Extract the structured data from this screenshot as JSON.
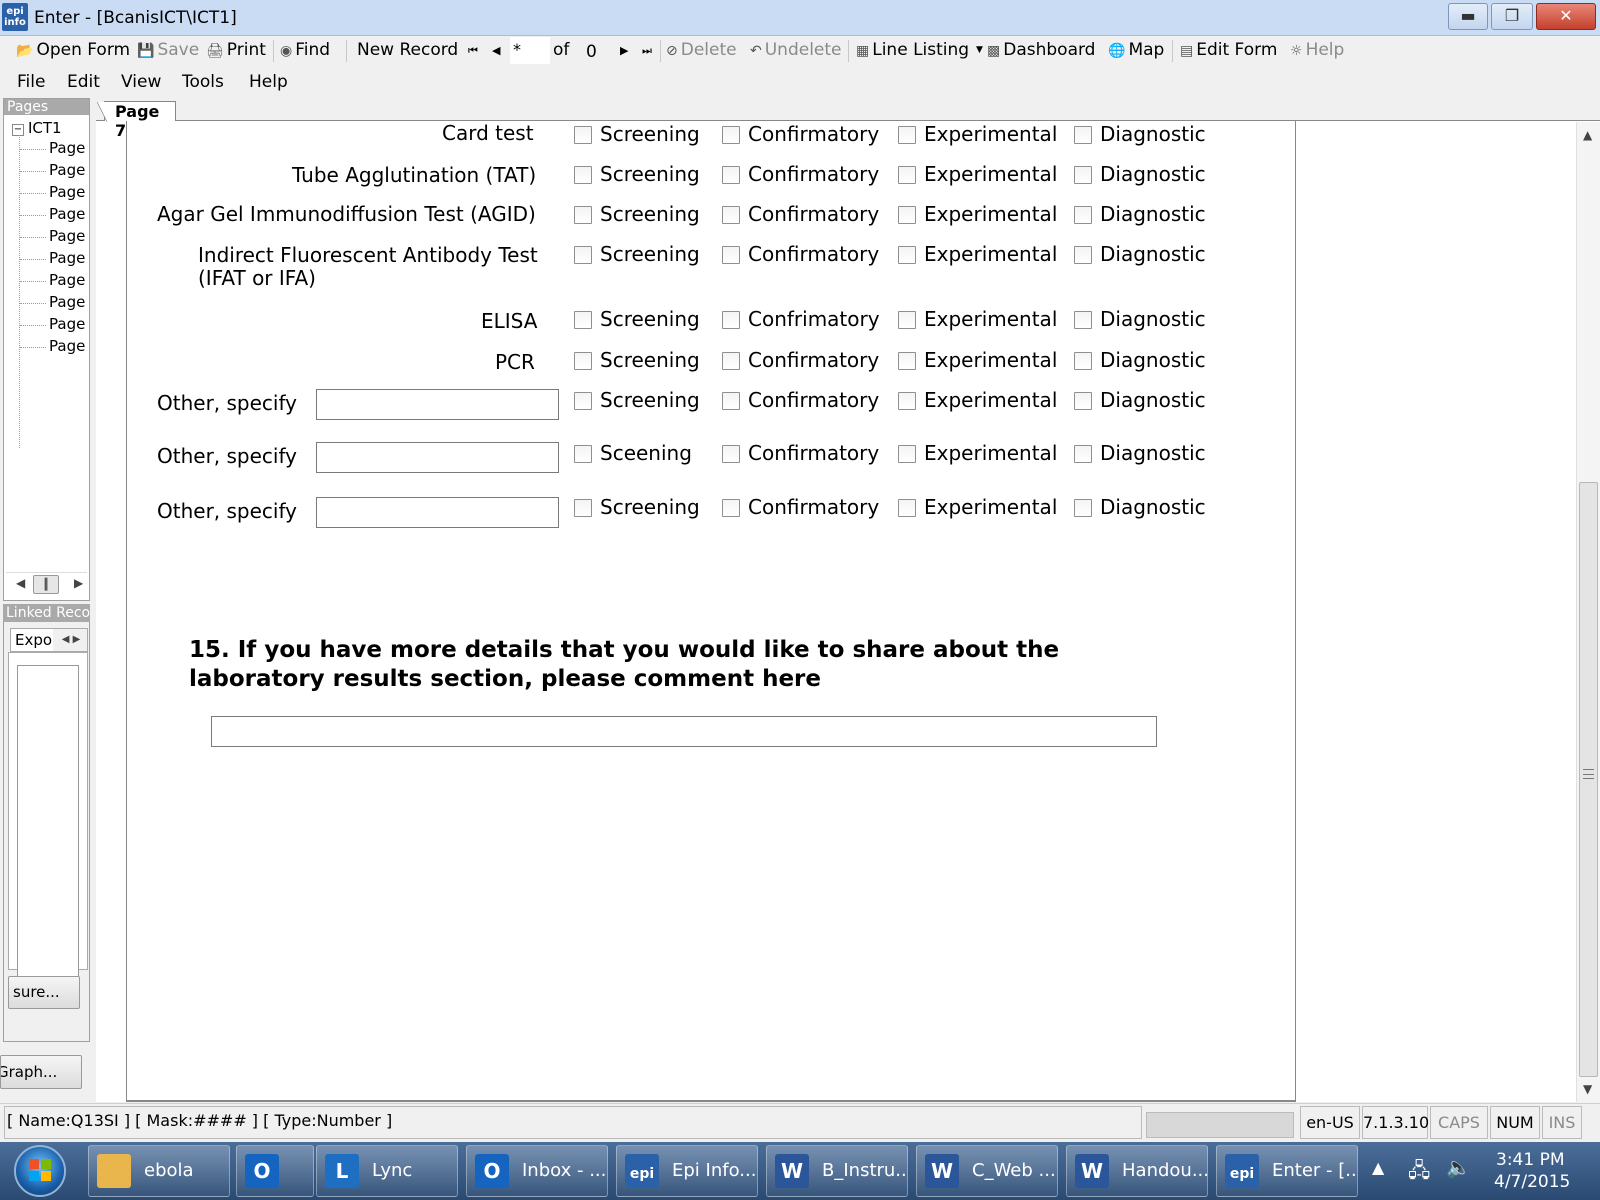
{
  "window": {
    "logo_top": "epi",
    "logo_bottom": "info",
    "title": "Enter - [BcanisICT\\ICT1]"
  },
  "toolbar": {
    "open_form": "Open Form",
    "save": "Save",
    "print": "Print",
    "find": "Find",
    "new_record": "New Record",
    "record_current": "*",
    "record_of": "of",
    "record_total": "0",
    "delete": "Delete",
    "undelete": "Undelete",
    "line_listing": "Line Listing",
    "dashboard": "Dashboard",
    "map": "Map",
    "edit_form": "Edit Form",
    "help": "Help"
  },
  "menu": [
    "File",
    "Edit",
    "View",
    "Tools",
    "Help"
  ],
  "pages_panel": {
    "header": "Pages",
    "root": "ICT1",
    "items": [
      "Page",
      "Page",
      "Page",
      "Page",
      "Page",
      "Page",
      "Page",
      "Page",
      "Page",
      "Page"
    ]
  },
  "linked_panel": {
    "header": "Linked Reco",
    "tab": "Expo",
    "exposure_button": "sure...",
    "graph_button": "Graph..."
  },
  "page_tab": "Page 7",
  "form": {
    "rows": [
      {
        "label": "Card test",
        "options": [
          "Screening",
          "Confirmatory",
          "Experimental",
          "Diagnostic"
        ]
      },
      {
        "label": "Tube Agglutination (TAT)",
        "options": [
          "Screening",
          "Confirmatory",
          "Experimental",
          "Diagnostic"
        ]
      },
      {
        "label": "Agar Gel Immunodiffusion Test (AGID)",
        "options": [
          "Screening",
          "Confirmatory",
          "Experimental",
          "Diagnostic"
        ]
      },
      {
        "label": "Indirect Fluorescent Antibody Test",
        "label_line2": "(IFAT or IFA)",
        "options": [
          "Screening",
          "Confirmatory",
          "Experimental",
          "Diagnostic"
        ]
      },
      {
        "label": "ELISA",
        "options": [
          "Screening",
          "Confrimatory",
          "Experimental",
          "Diagnostic"
        ]
      },
      {
        "label": "PCR",
        "options": [
          "Screening",
          "Confirmatory",
          "Experimental",
          "Diagnostic"
        ]
      },
      {
        "label": "Other, specify",
        "options": [
          "Screening",
          "Confirmatory",
          "Experimental",
          "Diagnostic"
        ]
      },
      {
        "label": "Other, specify",
        "options": [
          "Sceening",
          "Confirmatory",
          "Experimental",
          "Diagnostic"
        ]
      },
      {
        "label": "Other, specify",
        "options": [
          "Screening",
          "Confirmatory",
          "Experimental",
          "Diagnostic"
        ]
      }
    ],
    "question_15": "15. If you have more details that you would like to share about the laboratory results section, please comment here"
  },
  "statusbar": {
    "field_info": "[ Name:Q13SI ] [ Mask:#### ] [ Type:Number ]",
    "locale": "en-US",
    "version": "7.1.3.10",
    "caps": "CAPS",
    "num": "NUM",
    "ins": "INS"
  },
  "taskbar": {
    "items": [
      {
        "label": "ebola",
        "icon": "folder-icon",
        "color": "#e8b64c"
      },
      {
        "label": "",
        "icon": "outlook-icon",
        "color": "#1565c0",
        "glyph": "O"
      },
      {
        "label": "Lync",
        "icon": "lync-icon",
        "color": "#1e6fc2",
        "glyph": "L"
      },
      {
        "label": "Inbox - ...",
        "icon": "outlook-icon",
        "color": "#1565c0",
        "glyph": "O"
      },
      {
        "label": "Epi Info...",
        "icon": "epi-info-icon",
        "color": "#2a61a8",
        "glyph": "epi"
      },
      {
        "label": "B_Instru...",
        "icon": "word-icon",
        "color": "#2b579a",
        "glyph": "W"
      },
      {
        "label": "C_Web ...",
        "icon": "word-icon",
        "color": "#2b579a",
        "glyph": "W"
      },
      {
        "label": "Handou...",
        "icon": "word-icon",
        "color": "#2b579a",
        "glyph": "W"
      },
      {
        "label": "Enter - [...",
        "icon": "epi-info-icon",
        "color": "#2a61a8",
        "glyph": "epi"
      }
    ],
    "time": "3:41 PM",
    "date": "4/7/2015"
  }
}
